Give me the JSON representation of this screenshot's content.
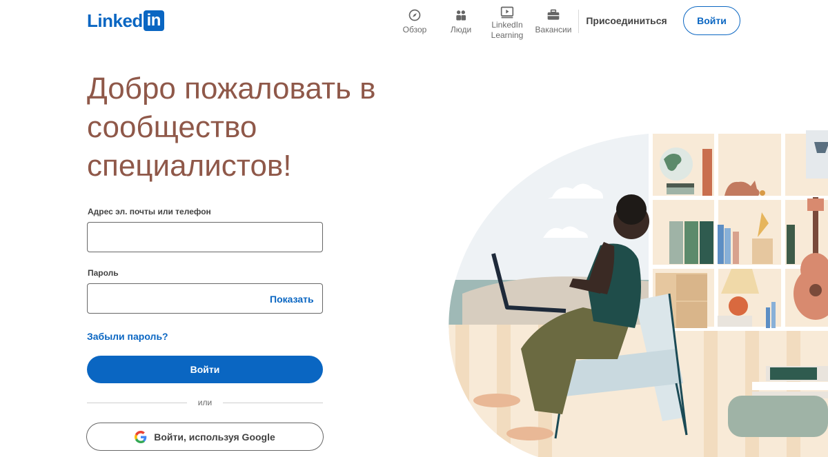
{
  "header": {
    "logo_word": "Linked",
    "logo_box": "in",
    "nav": [
      {
        "label": "Обзор",
        "icon": "compass-icon"
      },
      {
        "label": "Люди",
        "icon": "people-icon"
      },
      {
        "label": "LinkedIn Learning",
        "icon": "play-video-icon"
      },
      {
        "label": "Вакансии",
        "icon": "briefcase-icon"
      }
    ],
    "join_label": "Присоединиться",
    "signin_label": "Войти"
  },
  "headline": "Добро пожаловать в сообщество специалистов!",
  "form": {
    "email_label": "Адрес эл. почты или телефон",
    "email_value": "",
    "password_label": "Пароль",
    "password_value": "",
    "show_label": "Показать",
    "forgot_label": "Забыли пароль?",
    "submit_label": "Войти",
    "divider_text": "или",
    "google_label": "Войти, используя Google"
  },
  "colors": {
    "brand_blue": "#0a66c2",
    "headline_brown": "#8f5849"
  }
}
